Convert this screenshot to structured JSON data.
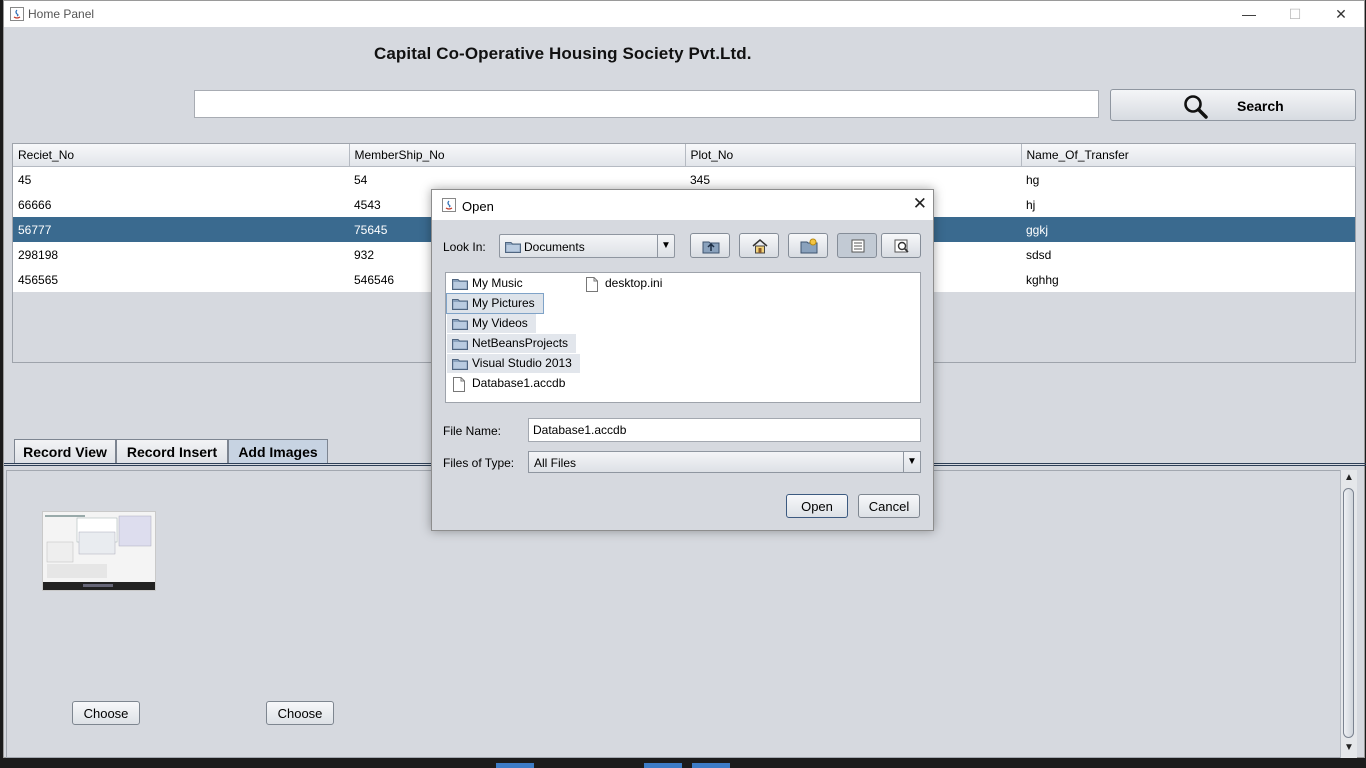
{
  "window": {
    "title": "Home Panel",
    "minimize_glyph": "—",
    "maximize_glyph": "☐",
    "close_glyph": "✕"
  },
  "header": {
    "title": "Capital Co-Operative Housing Society Pvt.Ltd."
  },
  "search": {
    "value": "",
    "button_label": "Search",
    "icon": "search-icon"
  },
  "table": {
    "columns": [
      "Reciet_No",
      "MemberShip_No",
      "Plot_No",
      "Name_Of_Transfer"
    ],
    "rows": [
      [
        "45",
        "54",
        "345",
        "hg"
      ],
      [
        "66666",
        "4543",
        "",
        "hj"
      ],
      [
        "56777",
        "75645",
        "",
        "ggkj"
      ],
      [
        "298198",
        "932",
        "",
        "sdsd"
      ],
      [
        "456565",
        "546546",
        "",
        "kghhg"
      ]
    ],
    "selected_row": 2
  },
  "tabs": [
    {
      "label": "Record View"
    },
    {
      "label": "Record Insert"
    },
    {
      "label": "Add Images",
      "active": true
    }
  ],
  "images_panel": {
    "choose_1": "Choose",
    "choose_2": "Choose"
  },
  "dialog": {
    "title": "Open",
    "close_glyph": "✕",
    "look_in_label": "Look In:",
    "look_in_value": "Documents",
    "toolbar_icons": [
      "up-folder-icon",
      "home-icon",
      "new-folder-icon",
      "list-view-icon",
      "details-view-icon"
    ],
    "files": [
      {
        "name": "My Music",
        "type": "folder"
      },
      {
        "name": "My Pictures",
        "type": "folder"
      },
      {
        "name": "My Videos",
        "type": "folder"
      },
      {
        "name": "NetBeansProjects",
        "type": "folder"
      },
      {
        "name": "Visual Studio 2013",
        "type": "folder"
      },
      {
        "name": "Database1.accdb",
        "type": "file"
      },
      {
        "name": "desktop.ini",
        "type": "file"
      }
    ],
    "file_name_label": "File Name:",
    "file_name_value": "Database1.accdb",
    "files_of_type_label": "Files of Type:",
    "files_of_type_value": "All Files",
    "open_label": "Open",
    "cancel_label": "Cancel"
  },
  "colors": {
    "selection": "#3a6a8f",
    "window_bg": "#d6d9df",
    "active_tab": "#c7d3e2"
  }
}
